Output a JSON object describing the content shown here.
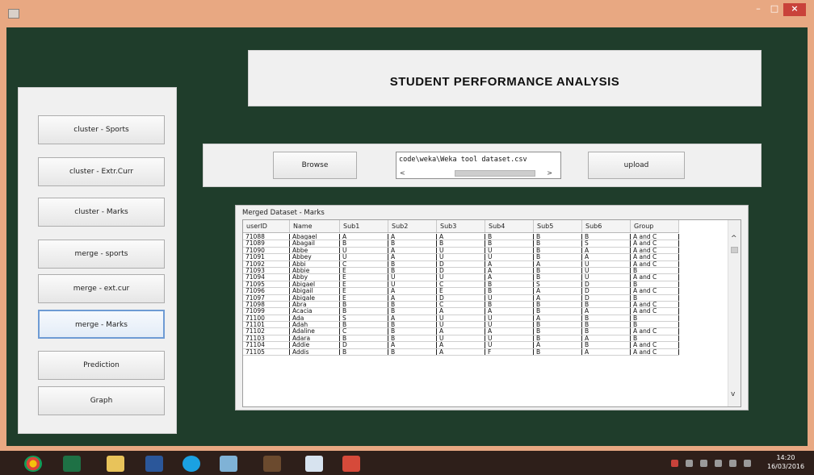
{
  "window": {
    "close_glyph": "×",
    "minimize_glyph": "–",
    "maximize_glyph": "□"
  },
  "header": {
    "title": "STUDENT PERFORMANCE ANALYSIS"
  },
  "sidebar": {
    "buttons": [
      {
        "label": "cluster - Sports"
      },
      {
        "label": "cluster - Extr.Curr"
      },
      {
        "label": "cluster - Marks"
      },
      {
        "label": "merge - sports"
      },
      {
        "label": "merge - ext.cur"
      },
      {
        "label": "merge - Marks"
      },
      {
        "label": "Prediction"
      },
      {
        "label": "Graph"
      }
    ]
  },
  "file_panel": {
    "browse_label": "Browse",
    "upload_label": "upload",
    "path_value": "code\\weka\\Weka tool dataset.csv",
    "scroll_left": "<",
    "scroll_right": ">"
  },
  "table": {
    "caption": "Merged Dataset - Marks",
    "columns": [
      "userID",
      "Name",
      "Sub1",
      "Sub2",
      "Sub3",
      "Sub4",
      "Sub5",
      "Sub6",
      "Group"
    ],
    "rows": [
      [
        "71088",
        "Abagael",
        "A",
        "A",
        "A",
        "B",
        "B",
        "B",
        "A and C"
      ],
      [
        "71089",
        "Abagail",
        "B",
        "B",
        "B",
        "B",
        "B",
        "S",
        "A and C"
      ],
      [
        "71090",
        "Abbe",
        "U",
        "A",
        "U",
        "U",
        "B",
        "A",
        "A and C"
      ],
      [
        "71091",
        "Abbey",
        "U",
        "A",
        "U",
        "U",
        "B",
        "A",
        "A and C"
      ],
      [
        "71092",
        "Abbi",
        "C",
        "B",
        "D",
        "A",
        "A",
        "U",
        "A and C"
      ],
      [
        "71093",
        "Abbie",
        "E",
        "B",
        "D",
        "A",
        "B",
        "U",
        "B"
      ],
      [
        "71094",
        "Abby",
        "E",
        "U",
        "U",
        "A",
        "B",
        "U",
        "A and C"
      ],
      [
        "71095",
        "Abigael",
        "E",
        "U",
        "C",
        "B",
        "S",
        "D",
        "B"
      ],
      [
        "71096",
        "Abigail",
        "E",
        "A",
        "E",
        "B",
        "A",
        "D",
        "A and C"
      ],
      [
        "71097",
        "Abigale",
        "E",
        "A",
        "D",
        "U",
        "A",
        "D",
        "B"
      ],
      [
        "71098",
        "Abra",
        "B",
        "B",
        "C",
        "B",
        "B",
        "B",
        "A and C"
      ],
      [
        "71099",
        "Acacia",
        "B",
        "B",
        "A",
        "A",
        "B",
        "A",
        "A and C"
      ],
      [
        "71100",
        "Ada",
        "S",
        "A",
        "U",
        "U",
        "A",
        "B",
        "B"
      ],
      [
        "71101",
        "Adah",
        "B",
        "B",
        "U",
        "U",
        "B",
        "B",
        "B"
      ],
      [
        "71102",
        "Adaline",
        "C",
        "B",
        "A",
        "A",
        "B",
        "B",
        "A and C"
      ],
      [
        "71103",
        "Adara",
        "B",
        "B",
        "U",
        "U",
        "B",
        "A",
        "B"
      ],
      [
        "71104",
        "Addie",
        "D",
        "A",
        "A",
        "U",
        "A",
        "B",
        "A and C"
      ],
      [
        "71105",
        "Addis",
        "B",
        "B",
        "A",
        "F",
        "B",
        "A",
        "A and C"
      ]
    ],
    "scroll_up": "^",
    "scroll_down": "v"
  },
  "taskbar": {
    "apps": [
      "chrome-icon",
      "excel-icon",
      "explorer-icon",
      "word-icon",
      "ie-icon",
      "notepad-icon",
      "app-icon",
      "java-icon",
      "acrobat-icon"
    ],
    "time": "14:20",
    "date": "16/03/2016"
  }
}
